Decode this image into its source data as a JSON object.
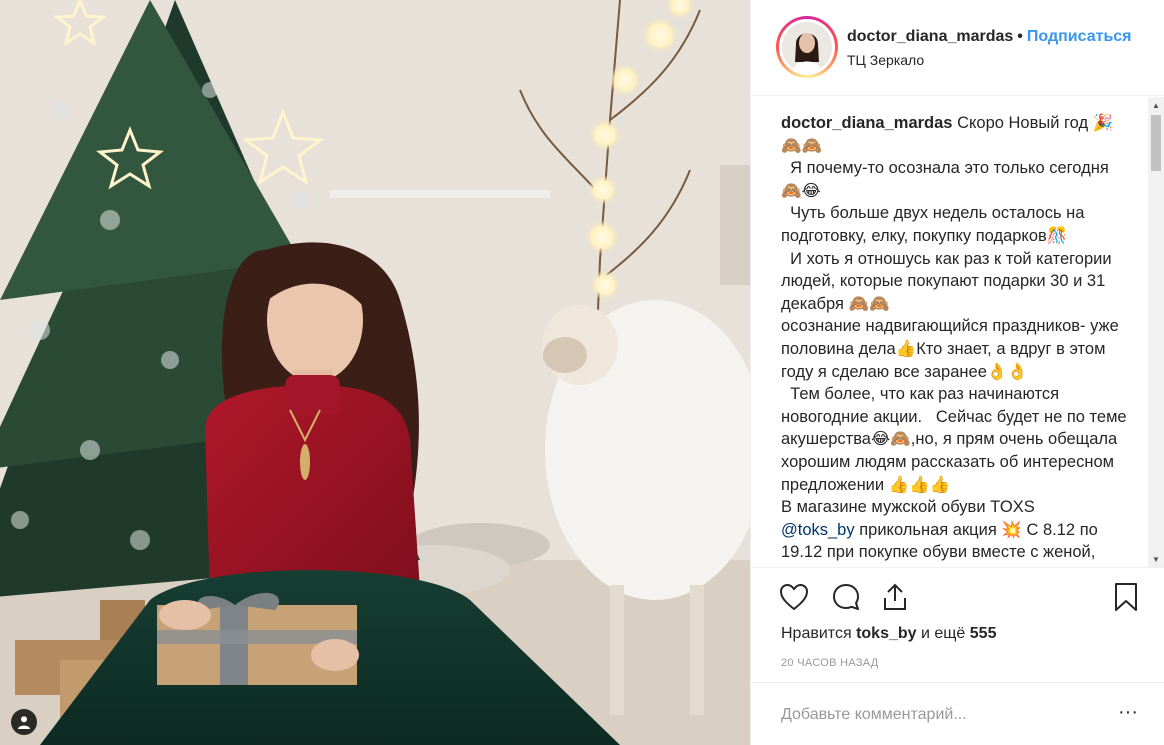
{
  "header": {
    "username": "doctor_diana_mardas",
    "separator": "•",
    "follow_label": "Подписаться",
    "location": "ТЦ Зеркало"
  },
  "caption": {
    "username": "doctor_diana_mardas",
    "text_part1": " Скоро Новый год 🎉🙈🙈\n  Я почему-то осознала это только сегодня 🙈😂\n  Чуть больше двух недель осталось на подготовку, елку, покупку подарков🎊\n  И хоть я отношусь как раз к той категории людей, которые покупают подарки 30 и 31 декабря 🙈🙈\nосознание надвигающийся праздников- уже половина дела👍Кто знает, а вдруг в этом году я сделаю все заранее👌👌\n  Тем более, что как раз начинаются новогодние акции.   Сейчас будет не по теме акушерства😂🙈,но, я прям очень обещала хорошим людям рассказать об интересном предложении 👍👍👍\nВ магазине мужской обуви TOXS\n",
    "mention": "@toks_by",
    "text_part2": " прикольная акция 💥 С 8.12 по 19.12 при покупке обуви вместе с женой,",
    "text_part3": " ... "
  },
  "actions": {
    "like_icon": "heart-icon",
    "comment_icon": "comment-icon",
    "share_icon": "share-icon",
    "save_icon": "bookmark-icon",
    "likes_prefix": "Нравится",
    "likes_user": "toks_by",
    "likes_middle": "и ещё",
    "likes_count": "555",
    "timestamp": "20 ЧАСОВ НАЗАД"
  },
  "comment": {
    "placeholder": "Добавьте комментарий...",
    "more_label": "···"
  },
  "colors": {
    "link_blue": "#3897f0",
    "text": "#262626",
    "muted": "#999999",
    "border": "#efefef"
  }
}
